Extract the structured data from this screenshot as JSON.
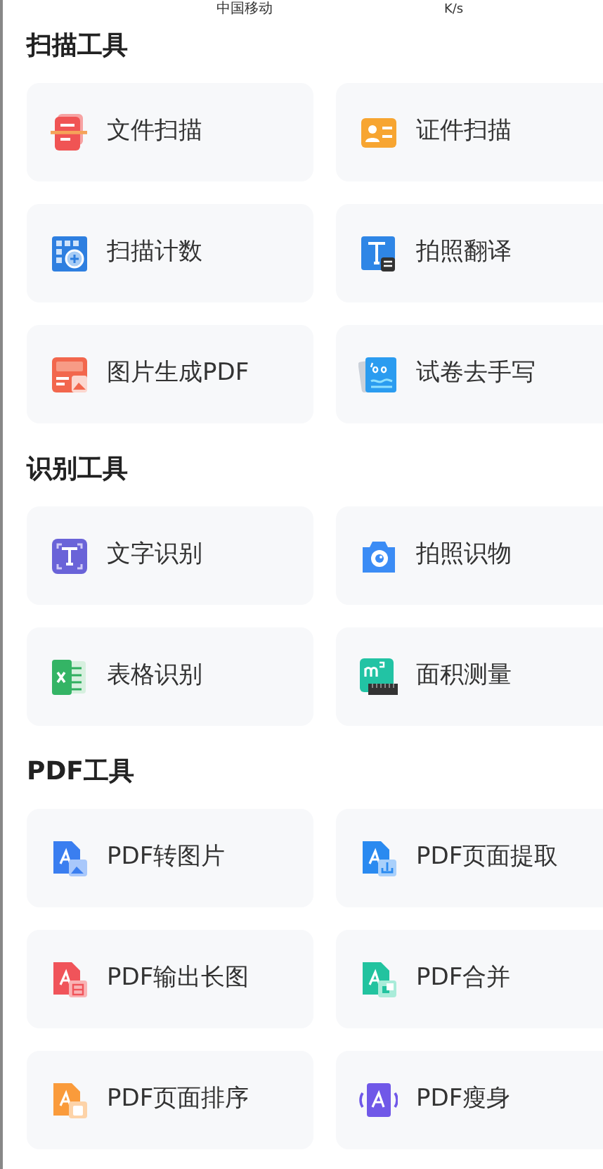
{
  "status_bar": {
    "carrier": "中国移动",
    "speed": "K/s"
  },
  "sections": [
    {
      "title": "扫描工具",
      "tools": [
        {
          "label": "文件扫描",
          "kind": "docscan"
        },
        {
          "label": "证件扫描",
          "kind": "idcard"
        },
        {
          "label": "扫描计数",
          "kind": "count"
        },
        {
          "label": "拍照翻译",
          "kind": "translate"
        },
        {
          "label": "图片生成PDF",
          "kind": "pdfgen"
        },
        {
          "label": "试卷去手写",
          "kind": "paper"
        }
      ]
    },
    {
      "title": "识别工具",
      "tools": [
        {
          "label": "文字识别",
          "kind": "ocr"
        },
        {
          "label": "拍照识物",
          "kind": "camera"
        },
        {
          "label": "表格识别",
          "kind": "sheet"
        },
        {
          "label": "面积测量",
          "kind": "area"
        }
      ]
    },
    {
      "title": "PDF工具",
      "tools": [
        {
          "label": "PDF转图片",
          "kind": "pdfimage"
        },
        {
          "label": "PDF页面提取",
          "kind": "pdfextract"
        },
        {
          "label": "PDF输出长图",
          "kind": "pdflong"
        },
        {
          "label": "PDF合并",
          "kind": "pdfmerge"
        },
        {
          "label": "PDF页面排序",
          "kind": "pdfsort"
        },
        {
          "label": "PDF瘦身",
          "kind": "pdfslim"
        }
      ]
    }
  ]
}
